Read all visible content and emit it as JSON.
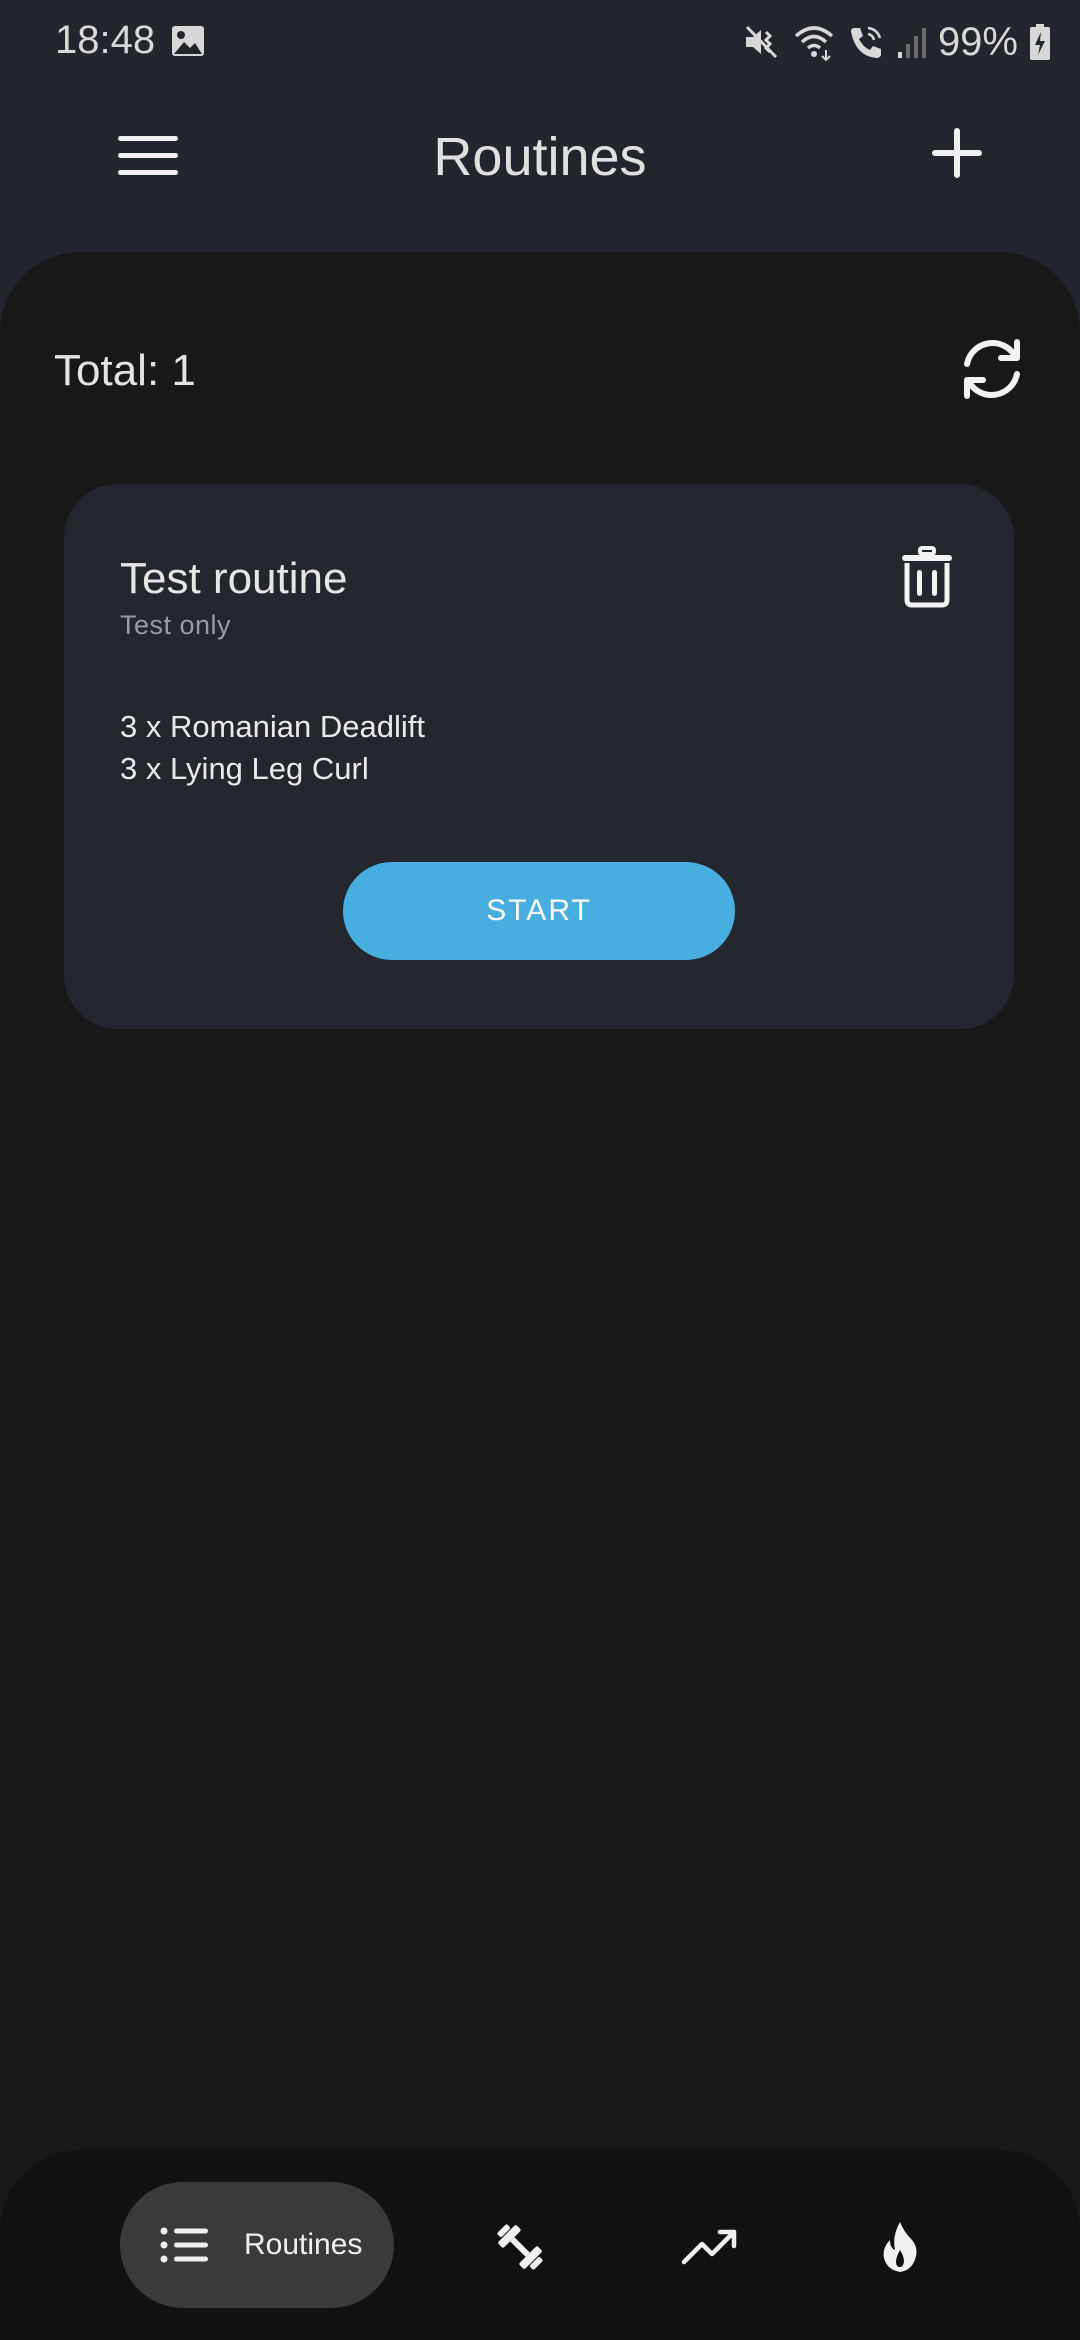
{
  "status_bar": {
    "time": "18:48",
    "battery": "99%",
    "icons": [
      "gallery-icon",
      "mute-icon",
      "wifi-icon",
      "wifi-call-icon",
      "signal-icon",
      "battery-charging-icon"
    ]
  },
  "app_bar": {
    "title": "Routines",
    "menu_icon": "hamburger-menu-icon",
    "add_icon": "plus-icon"
  },
  "summary": {
    "total_label": "Total: 1",
    "refresh_icon": "refresh-icon"
  },
  "routines": [
    {
      "title": "Test routine",
      "subtitle": "Test only",
      "exercises": [
        "3 x Romanian Deadlift",
        "3 x Lying Leg Curl"
      ],
      "start_label": "START",
      "delete_icon": "trash-icon"
    }
  ],
  "bottom_nav": {
    "items": [
      {
        "label": "Routines",
        "icon": "list-icon",
        "active": true
      },
      {
        "label": "",
        "icon": "dumbbell-icon",
        "active": false
      },
      {
        "label": "",
        "icon": "trending-up-icon",
        "active": false
      },
      {
        "label": "",
        "icon": "flame-icon",
        "active": false
      }
    ]
  },
  "colors": {
    "app_bar_bg": "#22252b",
    "content_bg": "#181818",
    "card_bg": "#23262c",
    "accent": "#48aee0",
    "nav_bg": "#111111",
    "nav_active_bg": "#3a3a3a"
  }
}
